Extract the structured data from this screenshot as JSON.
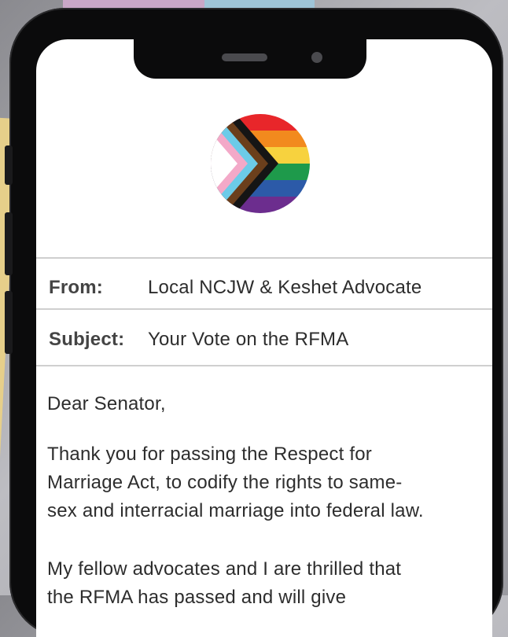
{
  "email": {
    "from_label": "From:",
    "from_value": "Local NCJW & Keshet Advocate",
    "subject_label": "Subject:",
    "subject_value": "Your Vote on the RFMA",
    "greeting": "Dear Senator,",
    "paragraph1_lines": [
      "Thank you for passing the Respect for",
      "Marriage Act, to codify the rights to same-",
      "sex and interracial marriage into federal law."
    ],
    "paragraph2_lines": [
      "My fellow advocates and I are thrilled that",
      "the RFMA has passed and will give"
    ]
  },
  "logo": {
    "icon": "progress-pride-flag-icon",
    "stripes": [
      "#e8262a",
      "#f28a1e",
      "#f7d23e",
      "#1e9a4b",
      "#2c5aa8",
      "#6c2d8e"
    ],
    "chevrons": [
      "#151515",
      "#6b3f1c",
      "#6ccbe8",
      "#f3a9c8",
      "#ffffff"
    ]
  }
}
